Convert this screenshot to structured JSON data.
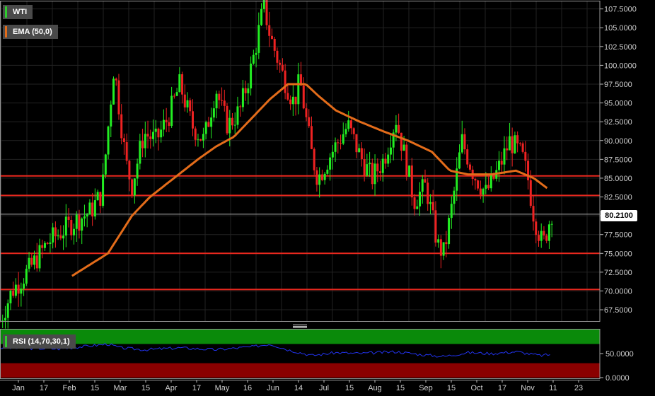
{
  "chart_data": [
    {
      "type": "candlestick",
      "name": "price-panel",
      "legend": [
        {
          "label": "WTI",
          "color": "#2ecc2e"
        },
        {
          "label": "EMA (50,0)",
          "color": "#e36c1a"
        }
      ],
      "y_ticks": [
        "107.5000",
        "105.0000",
        "102.5000",
        "100.0000",
        "97.5000",
        "95.0000",
        "92.5000",
        "90.0000",
        "87.5000",
        "85.0000",
        "82.5000",
        "80.0000",
        "77.5000",
        "75.0000",
        "72.5000",
        "70.0000",
        "67.5000"
      ],
      "ylim": [
        66,
        108.5
      ],
      "last_price": "80.2100",
      "horizontal_lines": [
        85.3,
        82.7,
        75.0,
        70.2
      ],
      "up_color": "#22ee22",
      "down_color": "#ee2222",
      "ema_color": "#e36c1a",
      "ema_anchors": [
        [
          0.12,
          72
        ],
        [
          0.18,
          75
        ],
        [
          0.2,
          77.5
        ],
        [
          0.22,
          80
        ],
        [
          0.25,
          82.5
        ],
        [
          0.29,
          85
        ],
        [
          0.33,
          87.5
        ],
        [
          0.36,
          89.2
        ],
        [
          0.39,
          90.5
        ],
        [
          0.42,
          93
        ],
        [
          0.45,
          95.5
        ],
        [
          0.48,
          97.5
        ],
        [
          0.51,
          97.5
        ],
        [
          0.53,
          96
        ],
        [
          0.56,
          94
        ],
        [
          0.6,
          92.5
        ],
        [
          0.64,
          91.2
        ],
        [
          0.68,
          90
        ],
        [
          0.72,
          88.5
        ],
        [
          0.75,
          86
        ],
        [
          0.78,
          85.5
        ],
        [
          0.82,
          85.5
        ],
        [
          0.86,
          86
        ],
        [
          0.89,
          85
        ],
        [
          0.915,
          83.5
        ]
      ],
      "price_anchors": [
        [
          0,
          66
        ],
        [
          0.02,
          70
        ],
        [
          0.05,
          73
        ],
        [
          0.08,
          76.5
        ],
        [
          0.12,
          79
        ],
        [
          0.15,
          80.5
        ],
        [
          0.17,
          83
        ],
        [
          0.19,
          100
        ],
        [
          0.21,
          87
        ],
        [
          0.22,
          84
        ],
        [
          0.24,
          91
        ],
        [
          0.26,
          90
        ],
        [
          0.28,
          93
        ],
        [
          0.3,
          97.5
        ],
        [
          0.32,
          92
        ],
        [
          0.34,
          90
        ],
        [
          0.36,
          97
        ],
        [
          0.37,
          94
        ],
        [
          0.38,
          92
        ],
        [
          0.4,
          94
        ],
        [
          0.42,
          100
        ],
        [
          0.44,
          108
        ],
        [
          0.45,
          104
        ],
        [
          0.47,
          99
        ],
        [
          0.49,
          95
        ],
        [
          0.5,
          98
        ],
        [
          0.52,
          88
        ],
        [
          0.53,
          85
        ],
        [
          0.55,
          88
        ],
        [
          0.58,
          92
        ],
        [
          0.6,
          88
        ],
        [
          0.62,
          85
        ],
        [
          0.64,
          87.5
        ],
        [
          0.66,
          93
        ],
        [
          0.68,
          86
        ],
        [
          0.69,
          82
        ],
        [
          0.71,
          84
        ],
        [
          0.73,
          76
        ],
        [
          0.74,
          75
        ],
        [
          0.755,
          82
        ],
        [
          0.77,
          90
        ],
        [
          0.79,
          85.5
        ],
        [
          0.81,
          83
        ],
        [
          0.83,
          86
        ],
        [
          0.85,
          90
        ],
        [
          0.87,
          88
        ],
        [
          0.88,
          85
        ],
        [
          0.89,
          80
        ],
        [
          0.905,
          76
        ],
        [
          0.92,
          80.5
        ]
      ]
    },
    {
      "type": "line",
      "name": "rsi-panel",
      "legend": [
        {
          "label": "RSI (14,70,30,1)",
          "color": "#2ecc2e"
        }
      ],
      "y_ticks": [
        "50.0000",
        "0.0000"
      ],
      "ylim": [
        0,
        100
      ],
      "overbought": 70,
      "oversold": 30,
      "line_color": "#2233ee",
      "rsi_anchors": [
        [
          0,
          62
        ],
        [
          0.1,
          60
        ],
        [
          0.15,
          66
        ],
        [
          0.18,
          70
        ],
        [
          0.2,
          62
        ],
        [
          0.24,
          58
        ],
        [
          0.3,
          62
        ],
        [
          0.36,
          58
        ],
        [
          0.42,
          64
        ],
        [
          0.45,
          70
        ],
        [
          0.48,
          58
        ],
        [
          0.52,
          46
        ],
        [
          0.56,
          52
        ],
        [
          0.6,
          50
        ],
        [
          0.66,
          54
        ],
        [
          0.7,
          48
        ],
        [
          0.74,
          44
        ],
        [
          0.78,
          52
        ],
        [
          0.82,
          50
        ],
        [
          0.86,
          54
        ],
        [
          0.9,
          46
        ],
        [
          0.92,
          48
        ]
      ]
    }
  ],
  "x_axis": {
    "labels": [
      "Jan",
      "17",
      "Feb",
      "15",
      "Mar",
      "15",
      "Apr",
      "17",
      "May",
      "16",
      "Jun",
      "14",
      "Jul",
      "15",
      "Aug",
      "15",
      "Sep",
      "15",
      "Oct",
      "17",
      "Nov",
      "11",
      "23"
    ]
  }
}
